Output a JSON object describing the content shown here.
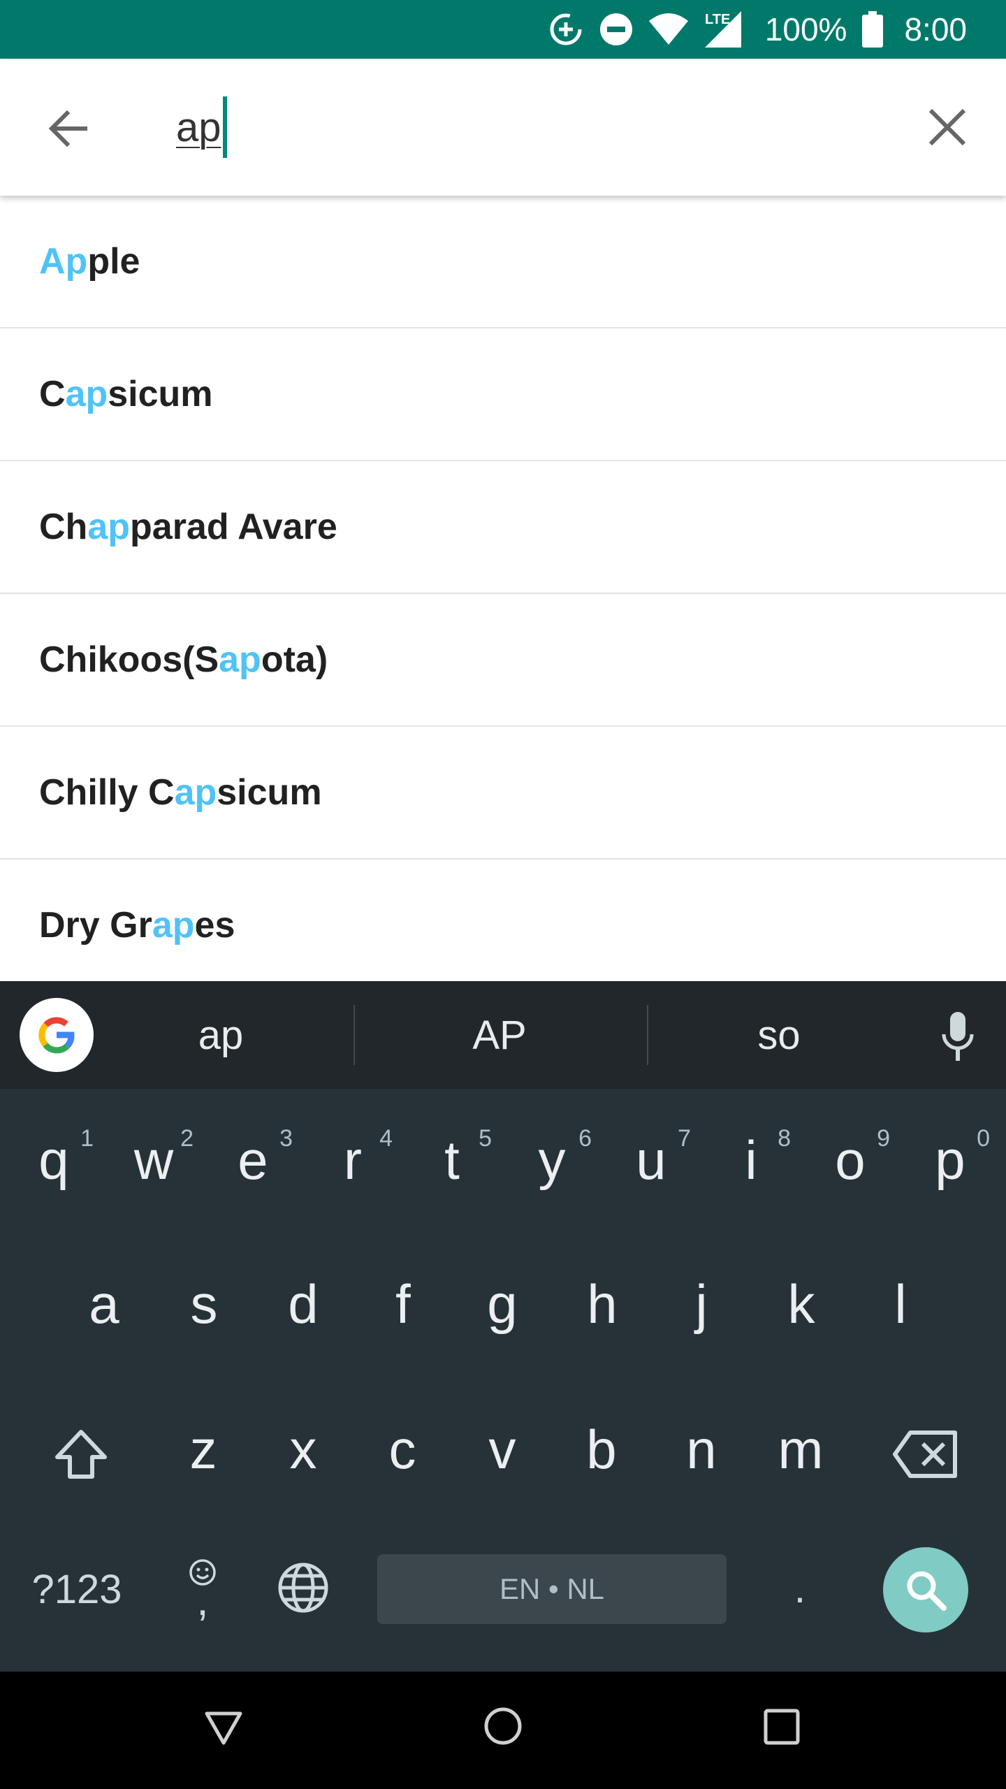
{
  "status_bar": {
    "battery": "100%",
    "time": "8:00",
    "network": "LTE"
  },
  "search": {
    "query": "ap"
  },
  "results": [
    {
      "parts": [
        {
          "t": "Ap",
          "h": true
        },
        {
          "t": "ple",
          "h": false
        }
      ]
    },
    {
      "parts": [
        {
          "t": "C",
          "h": false
        },
        {
          "t": "ap",
          "h": true
        },
        {
          "t": "sicum",
          "h": false
        }
      ]
    },
    {
      "parts": [
        {
          "t": "Ch",
          "h": false
        },
        {
          "t": "ap",
          "h": true
        },
        {
          "t": "parad Avare",
          "h": false
        }
      ]
    },
    {
      "parts": [
        {
          "t": "Chikoos(S",
          "h": false
        },
        {
          "t": "ap",
          "h": true
        },
        {
          "t": "ota)",
          "h": false
        }
      ]
    },
    {
      "parts": [
        {
          "t": "Chilly C",
          "h": false
        },
        {
          "t": "ap",
          "h": true
        },
        {
          "t": "sicum",
          "h": false
        }
      ]
    },
    {
      "parts": [
        {
          "t": "Dry Gr",
          "h": false
        },
        {
          "t": "ap",
          "h": true
        },
        {
          "t": "es",
          "h": false
        }
      ]
    }
  ],
  "keyboard": {
    "suggestions": [
      "ap",
      "AP",
      "so"
    ],
    "row1": [
      {
        "k": "q",
        "n": "1"
      },
      {
        "k": "w",
        "n": "2"
      },
      {
        "k": "e",
        "n": "3"
      },
      {
        "k": "r",
        "n": "4"
      },
      {
        "k": "t",
        "n": "5"
      },
      {
        "k": "y",
        "n": "6"
      },
      {
        "k": "u",
        "n": "7"
      },
      {
        "k": "i",
        "n": "8"
      },
      {
        "k": "o",
        "n": "9"
      },
      {
        "k": "p",
        "n": "0"
      }
    ],
    "row2": [
      "a",
      "s",
      "d",
      "f",
      "g",
      "h",
      "j",
      "k",
      "l"
    ],
    "row3": [
      "z",
      "x",
      "c",
      "v",
      "b",
      "n",
      "m"
    ],
    "symbols_label": "?123",
    "emoji_comma": ",",
    "space_label": "EN • NL",
    "period": "."
  },
  "colors": {
    "status_bar": "#00796b",
    "highlight": "#4fc3f7",
    "keyboard_bg": "#263238",
    "search_key": "#80cbc4"
  },
  "icons": [
    "sync-icon",
    "dnd-icon",
    "wifi-icon",
    "signal-icon",
    "battery-icon",
    "back-arrow-icon",
    "close-icon",
    "google-g-icon",
    "mic-icon",
    "shift-icon",
    "backspace-icon",
    "emoji-icon",
    "globe-icon",
    "search-icon",
    "nav-back-icon",
    "nav-home-icon",
    "nav-recents-icon"
  ]
}
